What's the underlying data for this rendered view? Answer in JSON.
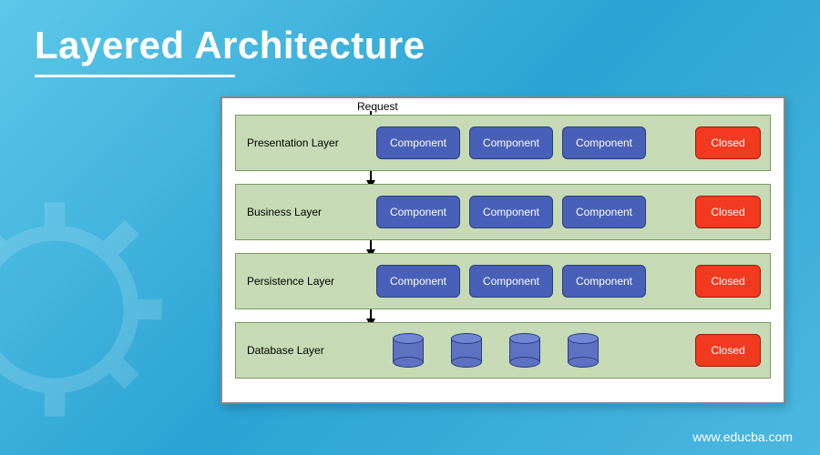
{
  "title": "Layered Architecture",
  "request_label": "Request",
  "layers": [
    {
      "name": "Presentation Layer",
      "components": [
        "Component",
        "Component",
        "Component"
      ],
      "status": "Closed"
    },
    {
      "name": "Business Layer",
      "components": [
        "Component",
        "Component",
        "Component"
      ],
      "status": "Closed"
    },
    {
      "name": "Persistence Layer",
      "components": [
        "Component",
        "Component",
        "Component"
      ],
      "status": "Closed"
    },
    {
      "name": "Database Layer",
      "db_count": 4,
      "status": "Closed"
    }
  ],
  "footer": "www.educba.com",
  "colors": {
    "layer_bg": "#c6dbb5",
    "component_bg": "#4860b7",
    "closed_bg": "#f13a1f"
  }
}
